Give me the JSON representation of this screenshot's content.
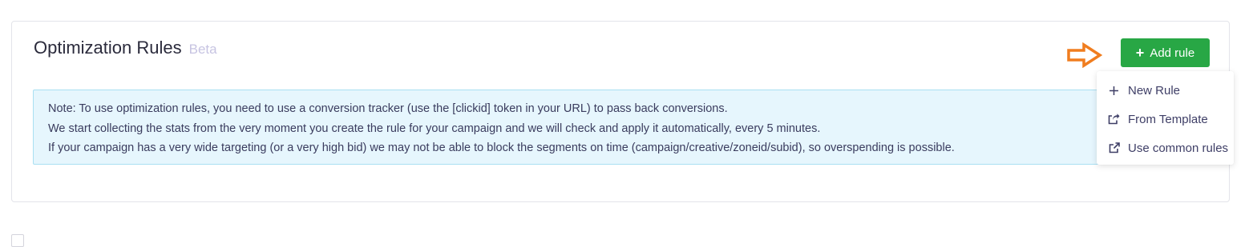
{
  "header": {
    "title": "Optimization Rules",
    "badge": "Beta"
  },
  "actions": {
    "add_rule_label": "Add rule"
  },
  "note": {
    "lines": [
      "Note: To use optimization rules, you need to use a conversion tracker (use the [clickid] token in your URL) to pass back conversions.",
      "We start collecting the stats from the very moment you create the rule for your campaign and we will check and apply it automatically, every 5 minutes.",
      "If your campaign has a very wide targeting (or a very high bid) we may not be able to block the segments on time (campaign/creative/zoneid/subid), so overspending is possible."
    ]
  },
  "dropdown": {
    "items": [
      {
        "label": "New Rule",
        "icon": "plus-icon"
      },
      {
        "label": "From Template",
        "icon": "share-icon"
      },
      {
        "label": "Use common rules",
        "icon": "external-link-icon"
      }
    ]
  },
  "colors": {
    "primary_button": "#28a745",
    "arrow": "#f07d1f",
    "note_background": "#e6f6fd",
    "note_border": "#a9dff2",
    "badge": "#c7c4e2"
  }
}
